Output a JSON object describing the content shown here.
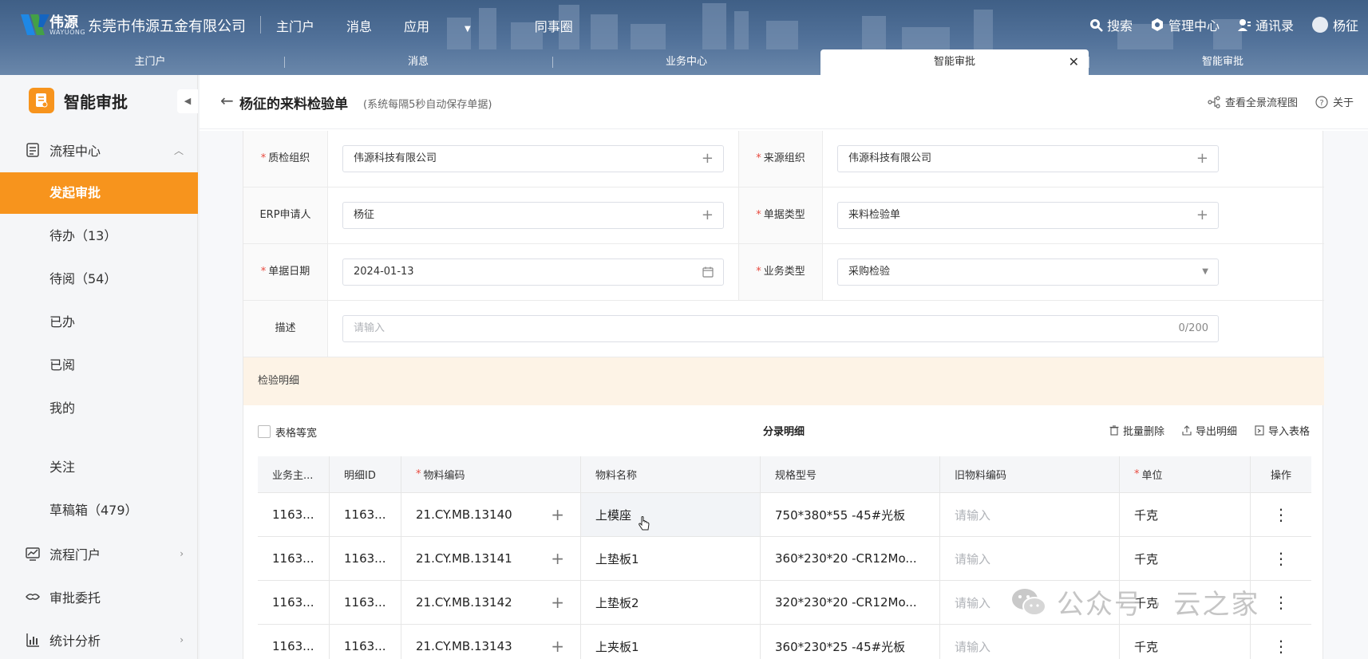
{
  "header": {
    "logo_cn": "伟源",
    "logo_en": "WAYUONG",
    "company": "东莞市伟源五金有限公司",
    "nav": [
      {
        "label": "主门户"
      },
      {
        "label": "消息"
      },
      {
        "label": "应用"
      },
      {
        "label": "同事圈"
      }
    ],
    "right": {
      "search": "搜索",
      "admin": "管理中心",
      "contacts": "通讯录",
      "user": "杨征"
    }
  },
  "tabs": [
    {
      "label": "主门户"
    },
    {
      "label": "消息"
    },
    {
      "label": "业务中心"
    },
    {
      "label": "智能审批",
      "active": true
    },
    {
      "label": "智能审批"
    }
  ],
  "sidebar": {
    "title": "智能审批",
    "groups": {
      "process_center": "流程中心",
      "process_portal": "流程门户",
      "delegate": "审批委托",
      "stats": "统计分析"
    },
    "items": [
      {
        "label": "发起审批",
        "active": true
      },
      {
        "label": "待办（13）"
      },
      {
        "label": "待阅（54）"
      },
      {
        "label": "已办"
      },
      {
        "label": "已阅"
      },
      {
        "label": "我的"
      },
      {
        "label": "关注"
      },
      {
        "label": "草稿箱（479）"
      }
    ]
  },
  "page": {
    "title": "杨征的来料检验单",
    "subtitle": "(系统每隔5秒自动保存单据)",
    "flow_view": "查看全景流程图",
    "about": "关于"
  },
  "form": {
    "quality_org": {
      "label": "质检组织",
      "value": "伟源科技有限公司"
    },
    "source_org": {
      "label": "来源组织",
      "value": "伟源科技有限公司"
    },
    "erp_applicant": {
      "label": "ERP申请人",
      "value": "杨征"
    },
    "doc_type": {
      "label": "单据类型",
      "value": "来料检验单"
    },
    "doc_date": {
      "label": "单据日期",
      "value": "2024-01-13"
    },
    "biz_type": {
      "label": "业务类型",
      "value": "采购检验"
    },
    "description": {
      "label": "描述",
      "placeholder": "请输入",
      "counter": "0/200"
    }
  },
  "detail": {
    "section": "检验明细",
    "equal_width": "表格等宽",
    "table_title": "分录明细",
    "actions": {
      "batch_delete": "批量删除",
      "export": "导出明细",
      "import": "导入表格"
    },
    "columns": [
      "业务主...",
      "明细ID",
      "物料编码",
      "物料名称",
      "规格型号",
      "旧物料编码",
      "单位",
      "操作"
    ],
    "rows": [
      {
        "biz": "1163...",
        "id": "1163...",
        "code": "21.CY.MB.13140",
        "name": "上模座",
        "spec": "750*380*55 -45#光板",
        "old": "请输入",
        "unit": "千克"
      },
      {
        "biz": "1163...",
        "id": "1163...",
        "code": "21.CY.MB.13141",
        "name": "上垫板1",
        "spec": "360*230*20 -CR12Mo...",
        "old": "请输入",
        "unit": "千克"
      },
      {
        "biz": "1163...",
        "id": "1163...",
        "code": "21.CY.MB.13142",
        "name": "上垫板2",
        "spec": "320*230*20 -CR12Mo...",
        "old": "请输入",
        "unit": "千克"
      },
      {
        "biz": "1163...",
        "id": "1163...",
        "code": "21.CY.MB.13143",
        "name": "上夹板1",
        "spec": "360*230*25 -45#光板",
        "old": "请输入",
        "unit": "千克"
      }
    ]
  },
  "watermark": "公众号 · 云之家",
  "colors": {
    "accent": "#f7941d",
    "header": "#4b6a92",
    "required": "#e84a3f",
    "section_bg": "#fdf3e6"
  }
}
